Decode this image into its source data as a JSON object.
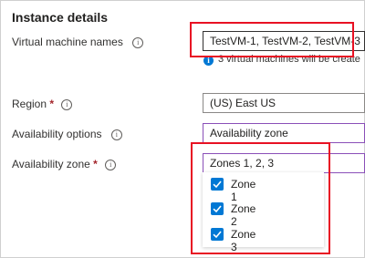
{
  "section": {
    "heading": "Instance details"
  },
  "fields": {
    "vm_names": {
      "label": "Virtual machine names",
      "value": "TestVM-1, TestVM-2, TestVM-3",
      "note": "3 virtual machines will be create"
    },
    "region": {
      "label": "Region",
      "required": "*",
      "value": "(US) East US"
    },
    "availability_options": {
      "label": "Availability options",
      "value": "Availability zone"
    },
    "availability_zone": {
      "label": "Availability zone",
      "required": "*",
      "value": "Zones 1, 2, 3",
      "options": [
        {
          "label": "Zone 1",
          "checked": true
        },
        {
          "label": "Zone 2",
          "checked": true
        },
        {
          "label": "Zone 3",
          "checked": true
        }
      ]
    }
  },
  "icons": {
    "info": "i",
    "note": "i"
  },
  "colors": {
    "accent": "#0078d4",
    "highlight": "#e81123",
    "focus": "#8a4fb8",
    "required": "#a4262c"
  }
}
